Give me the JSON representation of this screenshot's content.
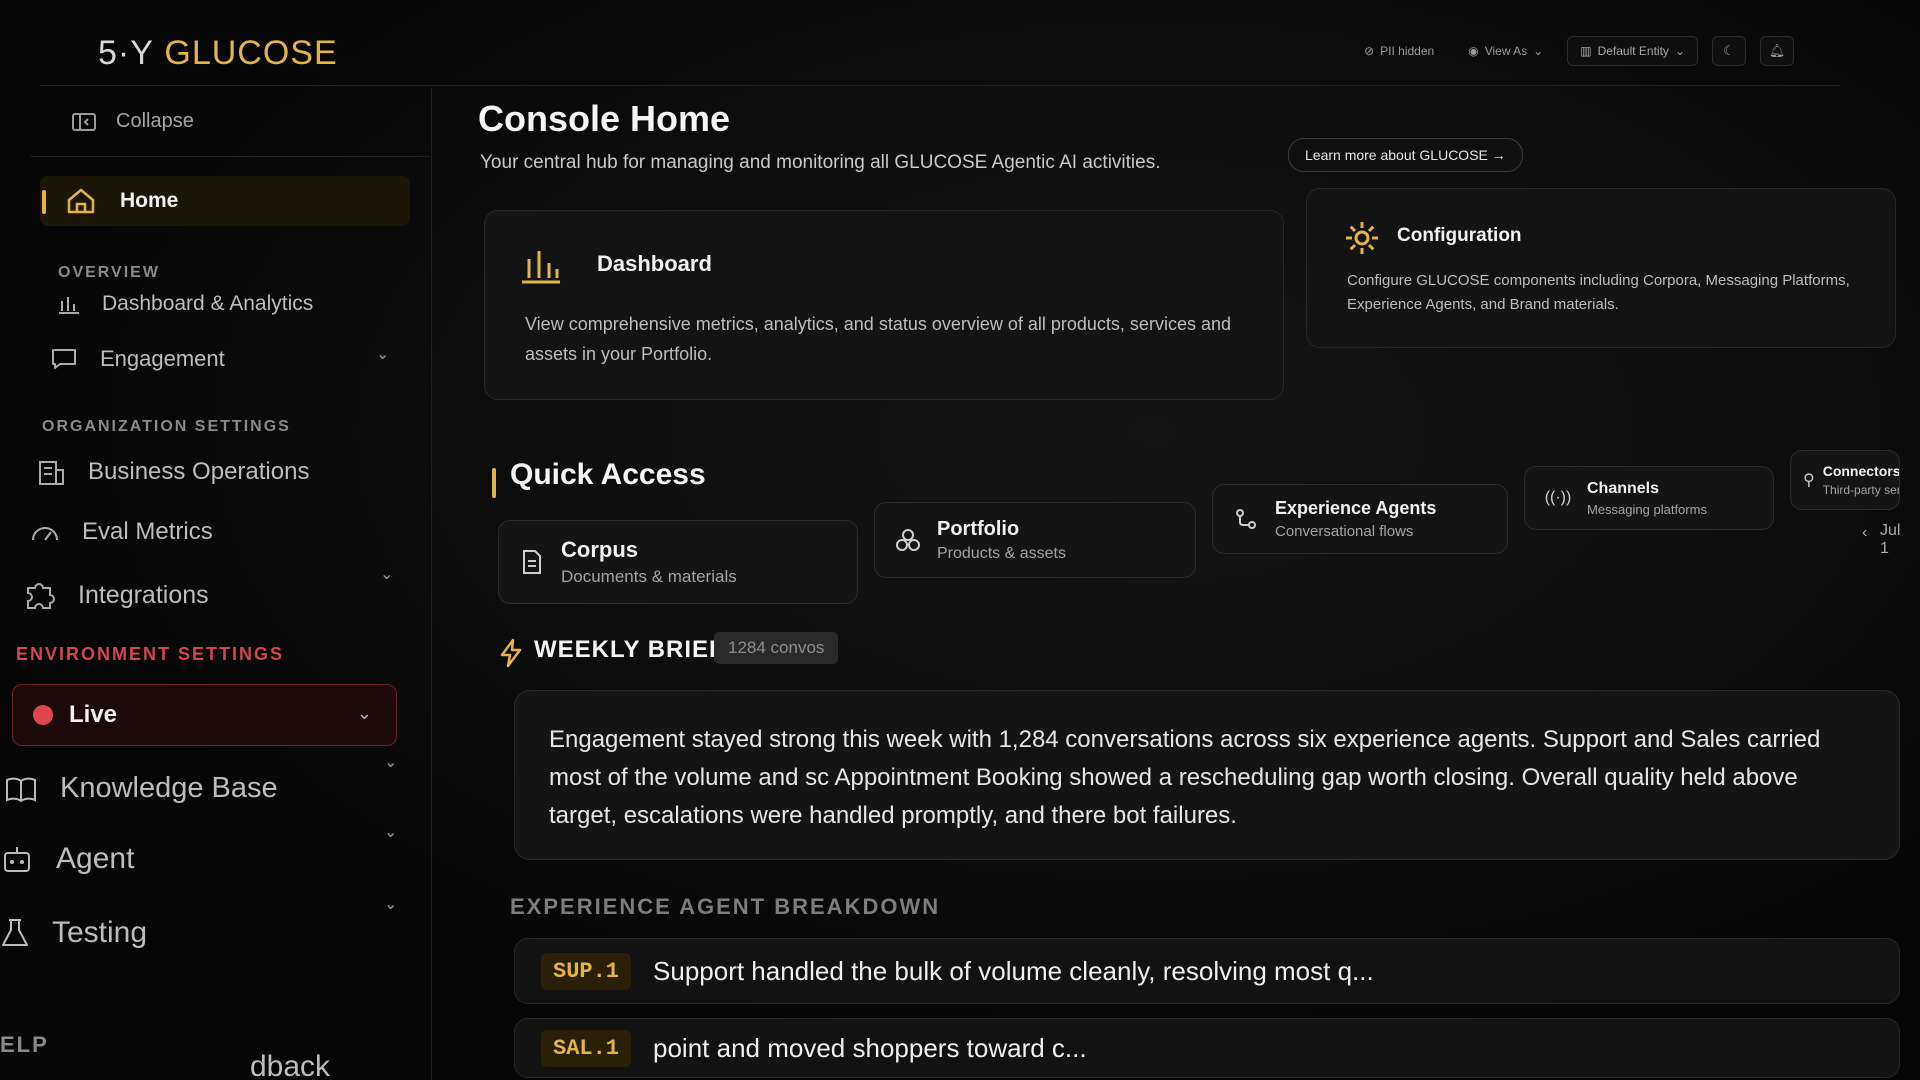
{
  "topbar": {
    "logo_prefix": "5·Y",
    "logo_brand": "GLUCOSE",
    "pii_label": "PII hidden",
    "view_as_label": "View As",
    "entity_label": "Default Entity"
  },
  "sidebar": {
    "collapse_label": "Collapse",
    "home_label": "Home",
    "section_overview": "OVERVIEW",
    "dashboard_label": "Dashboard & Analytics",
    "engagement_label": "Engagement",
    "section_org": "ORGANIZATION SETTINGS",
    "business_label": "Business Operations",
    "eval_label": "Eval Metrics",
    "integrations_label": "Integrations",
    "section_env": "ENVIRONMENT SETTINGS",
    "env_value": "Live",
    "knowledge_label": "Knowledge Base",
    "agent_label": "Agent",
    "testing_label": "Testing",
    "section_help": "ELP",
    "feedback_partial": "dback"
  },
  "main": {
    "title": "Console Home",
    "subtitle": "Your central hub for managing and monitoring all GLUCOSE Agentic AI activities.",
    "learn_more": "Learn more about GLUCOSE →",
    "dashboard_card": {
      "title": "Dashboard",
      "desc": "View comprehensive metrics, analytics, and status overview of all products, services and assets in your Portfolio."
    },
    "config_card": {
      "title": "Configuration",
      "desc": "Configure GLUCOSE components including Corpora, Messaging Platforms, Experience Agents, and Brand materials."
    },
    "quick_access_title": "Quick Access",
    "quick_access": [
      {
        "name": "Corpus",
        "desc": "Documents & materials",
        "icon": "document-icon"
      },
      {
        "name": "Portfolio",
        "desc": "Products & assets",
        "icon": "boxes-icon"
      },
      {
        "name": "Experience Agents",
        "desc": "Conversational flows",
        "icon": "flow-icon"
      },
      {
        "name": "Channels",
        "desc": "Messaging platforms",
        "icon": "broadcast-icon"
      },
      {
        "name": "Connectors",
        "desc": "Third-party services",
        "icon": "plug-icon"
      }
    ],
    "pager_prev": "‹",
    "pager_date": "Jul 1",
    "brief_title": "WEEKLY BRIEF",
    "brief_badge": "1284 convos",
    "brief_text": "Engagement stayed strong this week with 1,284 conversations across six experience agents. Support and Sales carried most of the volume and sc Appointment Booking showed a rescheduling gap worth closing. Overall quality held above target, escalations were handled promptly, and there bot failures.",
    "breakdown_title": "EXPERIENCE AGENT BREAKDOWN",
    "breakdown": [
      {
        "code": "SUP.1",
        "text": "Support handled the bulk of volume cleanly, resolving most q..."
      },
      {
        "code": "SAL.1",
        "text": "point and moved shoppers toward c..."
      }
    ]
  },
  "colors": {
    "accent": "#e2b44a",
    "env_live": "#e0454a",
    "background": "#050505"
  }
}
